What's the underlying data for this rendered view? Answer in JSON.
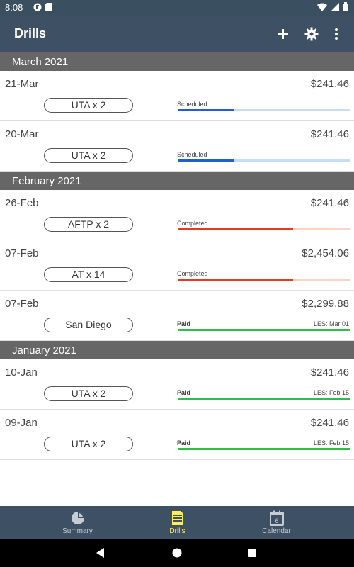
{
  "status_bar": {
    "time": "8:08"
  },
  "app_bar": {
    "title": "Drills"
  },
  "colors": {
    "scheduled_fill": "#1e5fd2",
    "scheduled_track": "#c7dcf6",
    "completed_fill": "#e8391e",
    "completed_track": "#fbd3c5",
    "paid_fill": "#2ebd46",
    "active_nav": "#ffee58"
  },
  "sections": [
    {
      "month": "March 2021",
      "rows": [
        {
          "date": "21-Mar",
          "amount": "$241.46",
          "drill": "UTA x 2",
          "status": "Scheduled",
          "les": "",
          "progress": 0.33,
          "type": "scheduled"
        },
        {
          "date": "20-Mar",
          "amount": "$241.46",
          "drill": "UTA x 2",
          "status": "Scheduled",
          "les": "",
          "progress": 0.33,
          "type": "scheduled"
        }
      ]
    },
    {
      "month": "February 2021",
      "rows": [
        {
          "date": "26-Feb",
          "amount": "$241.46",
          "drill": "AFTP x 2",
          "status": "Completed",
          "les": "",
          "progress": 0.67,
          "type": "completed"
        },
        {
          "date": "07-Feb",
          "amount": "$2,454.06",
          "drill": "AT x 14",
          "status": "Completed",
          "les": "",
          "progress": 0.67,
          "type": "completed"
        },
        {
          "date": "07-Feb",
          "amount": "$2,299.88",
          "drill": "San Diego",
          "status": "Paid",
          "les": "LES: Mar 01",
          "progress": 1.0,
          "type": "paid"
        }
      ]
    },
    {
      "month": "January 2021",
      "rows": [
        {
          "date": "10-Jan",
          "amount": "$241.46",
          "drill": "UTA x 2",
          "status": "Paid",
          "les": "LES: Feb 15",
          "progress": 1.0,
          "type": "paid"
        },
        {
          "date": "09-Jan",
          "amount": "$241.46",
          "drill": "UTA x 2",
          "status": "Paid",
          "les": "LES: Feb 15",
          "progress": 1.0,
          "type": "paid"
        }
      ]
    }
  ],
  "bottom_nav": [
    {
      "label": "Summary",
      "icon": "pie-chart-icon",
      "active": false
    },
    {
      "label": "Drills",
      "icon": "list-document-icon",
      "active": true
    },
    {
      "label": "Calendar",
      "icon": "calendar-icon",
      "active": false,
      "icon_text": "6"
    }
  ]
}
